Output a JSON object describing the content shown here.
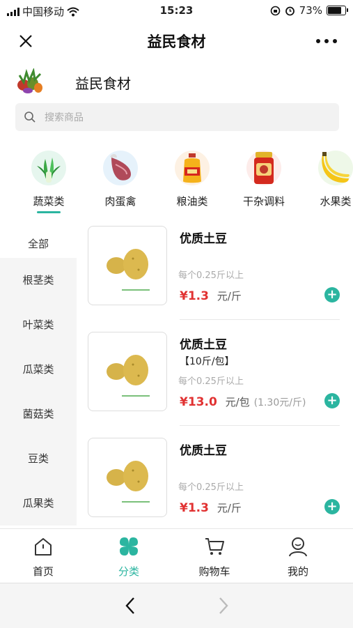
{
  "status": {
    "carrier": "中国移动",
    "time": "15:23",
    "battery": "73%"
  },
  "header": {
    "title": "益民食材"
  },
  "shop": {
    "name": "益民食材"
  },
  "search": {
    "placeholder": "搜索商品"
  },
  "categories": [
    {
      "label": "蔬菜类",
      "icon": "vegetable-icon",
      "active": true
    },
    {
      "label": "肉蛋禽",
      "icon": "meat-icon"
    },
    {
      "label": "粮油类",
      "icon": "oil-icon"
    },
    {
      "label": "干杂调料",
      "icon": "sauce-jar-icon"
    },
    {
      "label": "水果类",
      "icon": "banana-icon"
    }
  ],
  "subcategories": [
    "全部",
    "根茎类",
    "叶菜类",
    "瓜菜类",
    "菌菇类",
    "豆类",
    "瓜果类"
  ],
  "products": [
    {
      "name": "优质土豆",
      "spec": "",
      "min_order": "每个0.25斤以上",
      "price": "¥1.3",
      "unit": "元/斤",
      "unit_price": ""
    },
    {
      "name": "优质土豆",
      "spec": "【10斤/包】",
      "min_order": "每个0.25斤以上",
      "price": "¥13.0",
      "unit": "元/包",
      "unit_price": "(1.30元/斤)"
    },
    {
      "name": "优质土豆",
      "spec": "",
      "min_order": "每个0.25斤以上",
      "price": "¥1.3",
      "unit": "元/斤",
      "unit_price": ""
    }
  ],
  "tabbar": [
    {
      "label": "首页",
      "icon": "home-icon"
    },
    {
      "label": "分类",
      "icon": "category-icon",
      "active": true
    },
    {
      "label": "购物车",
      "icon": "cart-icon"
    },
    {
      "label": "我的",
      "icon": "profile-icon"
    }
  ],
  "colors": {
    "accent": "#2bb5a0",
    "price": "#e13232"
  }
}
